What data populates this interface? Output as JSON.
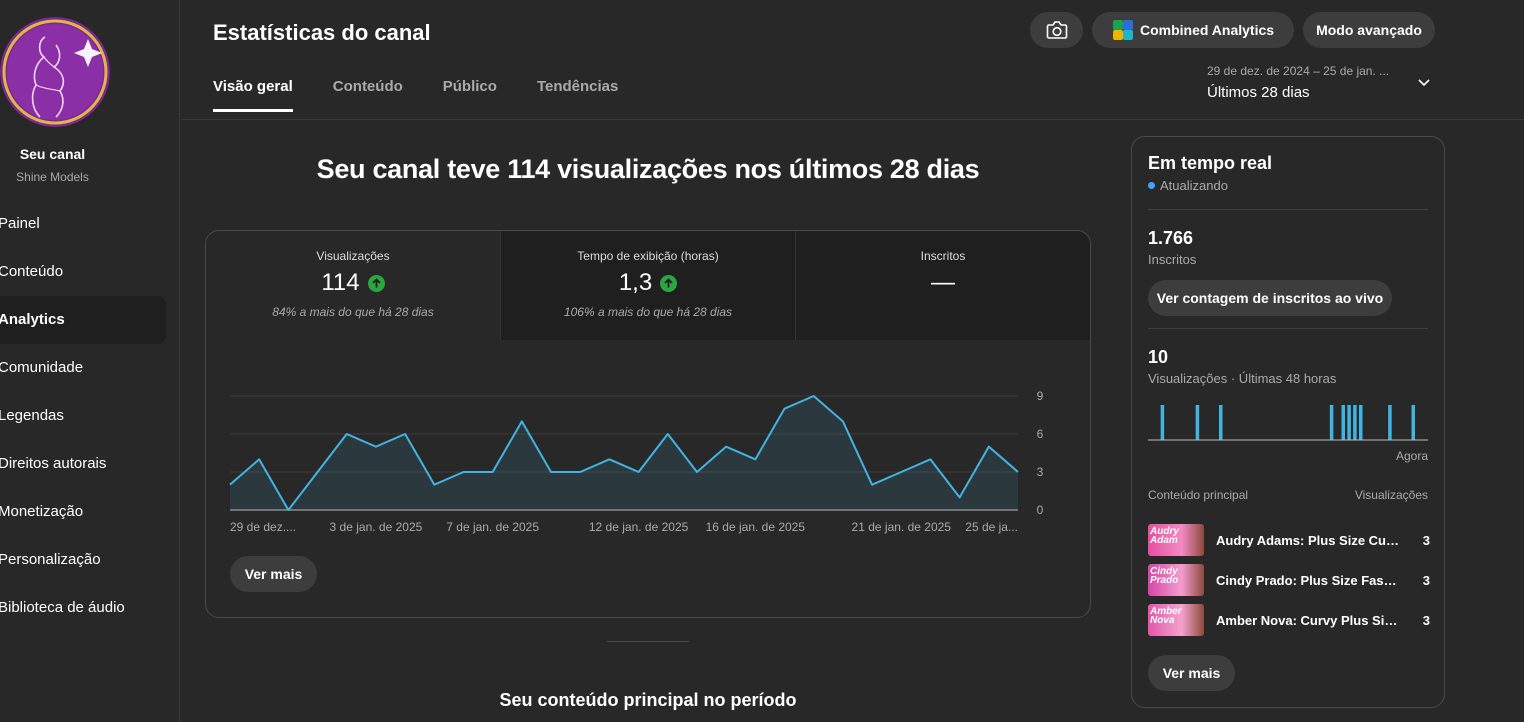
{
  "channel": {
    "title": "Seu canal",
    "name": "Shine Models"
  },
  "nav": [
    {
      "label": "Painel",
      "id": "painel",
      "active": false
    },
    {
      "label": "Conteúdo",
      "id": "conteudo",
      "active": false
    },
    {
      "label": "Analytics",
      "id": "analytics",
      "active": true
    },
    {
      "label": "Comunidade",
      "id": "comunidade",
      "active": false
    },
    {
      "label": "Legendas",
      "id": "legendas",
      "active": false
    },
    {
      "label": "Direitos autorais",
      "id": "direitos-autorais",
      "active": false
    },
    {
      "label": "Monetização",
      "id": "monetizacao",
      "active": false
    },
    {
      "label": "Personalização",
      "id": "personalizacao",
      "active": false
    },
    {
      "label": "Biblioteca de áudio",
      "id": "biblioteca-de-audio",
      "active": false
    }
  ],
  "header": {
    "title": "Estatísticas do canal",
    "combined_label": "Combined Analytics",
    "advanced_label": "Modo avançado",
    "date_range": "29 de dez. de 2024 – 25 de jan. ...",
    "date_preset": "Últimos 28 dias"
  },
  "tabs": [
    "Visão geral",
    "Conteúdo",
    "Público",
    "Tendências"
  ],
  "overview": {
    "headline": "Seu canal teve 114 visualizações nos últimos 28 dias",
    "metrics": [
      {
        "label": "Visualizações",
        "value": "114",
        "trend": "up",
        "note": "84% a mais do que há 28 dias"
      },
      {
        "label": "Tempo de exibição (horas)",
        "value": "1,3",
        "trend": "up",
        "note": "106% a mais do que há 28 dias"
      },
      {
        "label": "Inscritos",
        "value": "—",
        "trend": "",
        "note": ""
      }
    ],
    "see_more": "Ver mais",
    "section_title": "Seu conteúdo principal no período"
  },
  "chart_data": {
    "type": "area",
    "x": [
      "29 de dez.",
      "30 de dez.",
      "31 de dez.",
      "1 de jan.",
      "2 de jan.",
      "3 de jan.",
      "4 de jan.",
      "5 de jan.",
      "6 de jan.",
      "7 de jan.",
      "8 de jan.",
      "9 de jan.",
      "10 de jan.",
      "11 de jan.",
      "12 de jan.",
      "13 de jan.",
      "14 de jan.",
      "15 de jan.",
      "16 de jan.",
      "17 de jan.",
      "18 de jan.",
      "19 de jan.",
      "20 de jan.",
      "21 de jan.",
      "22 de jan.",
      "23 de jan.",
      "24 de jan.",
      "25 de jan."
    ],
    "series": [
      {
        "values": [
          2,
          4,
          0,
          3,
          6,
          5,
          6,
          2,
          3,
          3,
          7,
          3,
          3,
          4,
          3,
          6,
          3,
          5,
          4,
          8,
          9,
          7,
          2,
          3,
          4,
          1,
          5,
          3
        ]
      }
    ],
    "x_tick_labels": [
      {
        "index": 0,
        "label": "29 de dez...."
      },
      {
        "index": 5,
        "label": "3 de jan. de 2025"
      },
      {
        "index": 9,
        "label": "7 de jan. de 2025"
      },
      {
        "index": 14,
        "label": "12 de jan. de 2025"
      },
      {
        "index": 18,
        "label": "16 de jan. de 2025"
      },
      {
        "index": 23,
        "label": "21 de jan. de 2025"
      },
      {
        "index": 27,
        "label": "25 de ja..."
      }
    ],
    "y_ticks": [
      0,
      3,
      6,
      9
    ],
    "ylim": [
      0,
      9.5
    ],
    "grid": true,
    "line_color": "#41b4e1"
  },
  "realtime": {
    "title": "Em tempo real",
    "status": "Atualizando",
    "subscribers_value": "1.766",
    "subscribers_label": "Inscritos",
    "live_count_button": "Ver contagem de inscritos ao vivo",
    "views_value": "10",
    "views_label": "Visualizações · Últimas 48 horas",
    "now_label": "Agora",
    "bars_chart": {
      "type": "bar",
      "hours": 48,
      "views_by_hour": [
        0,
        0,
        1,
        0,
        0,
        0,
        0,
        0,
        1,
        0,
        0,
        0,
        1,
        0,
        0,
        0,
        0,
        0,
        0,
        0,
        0,
        0,
        0,
        0,
        0,
        0,
        0,
        0,
        0,
        0,
        0,
        1,
        0,
        1,
        1,
        1,
        1,
        0,
        0,
        0,
        0,
        1,
        0,
        0,
        0,
        1,
        0,
        0
      ]
    },
    "content_header": "Conteúdo principal",
    "views_header": "Visualizações",
    "top_content": [
      {
        "title": "Audry Adams: Plus Size Curvy Model",
        "thumb_text": "Audry Adam",
        "views": "3"
      },
      {
        "title": "Cindy Prado: Plus Size Fashion Model",
        "thumb_text": "Cindy Prado",
        "views": "3"
      },
      {
        "title": "Amber Nova: Curvy Plus Size Model",
        "thumb_text": "Amber Nova",
        "views": "3"
      }
    ],
    "see_more": "Ver mais"
  },
  "colors": {
    "bg": "#282828",
    "accent_line": "#41b4e1",
    "trend_up": "#2ba640",
    "live_dot": "#3ea6ff"
  }
}
